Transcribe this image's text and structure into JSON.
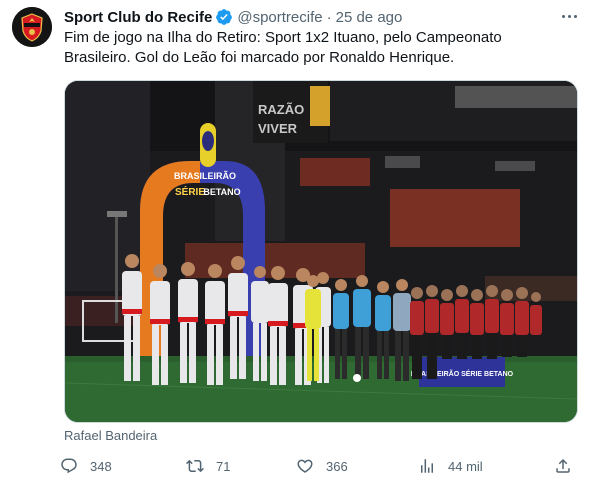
{
  "author": {
    "name": "Sport Club do Recife",
    "handle": "@sportrecife",
    "separator": "·",
    "time": "25 de ago"
  },
  "tweet": {
    "text": "Fim de jogo na Ilha do Retiro: Sport 1x2 Ituano, pelo Campeonato\nBrasileiro. Gol do Leão foi marcado por Ronaldo Henrique."
  },
  "media": {
    "credit": "Rafael Bandeira",
    "arch_line1": "BRASILEIRÃO",
    "arch_line2": "SÉRIE",
    "arch_line3": "BETANO",
    "board_text": "BRASILEIRÃO SÉRIE BETANO",
    "stand_text1": "RAZÃO",
    "stand_text2": "VIVER"
  },
  "actions": {
    "replies": "348",
    "retweets": "71",
    "likes": "366",
    "views": "44 mil"
  },
  "icons": {
    "verified": "verified-badge-icon",
    "more": "more-options-icon",
    "reply": "reply-icon",
    "retweet": "retweet-icon",
    "like": "heart-icon",
    "views": "views-icon",
    "share": "share-icon"
  },
  "colors": {
    "text": "#0f1419",
    "secondary": "#536471",
    "verified": "#1d9bf0",
    "club_red": "#d71920"
  }
}
